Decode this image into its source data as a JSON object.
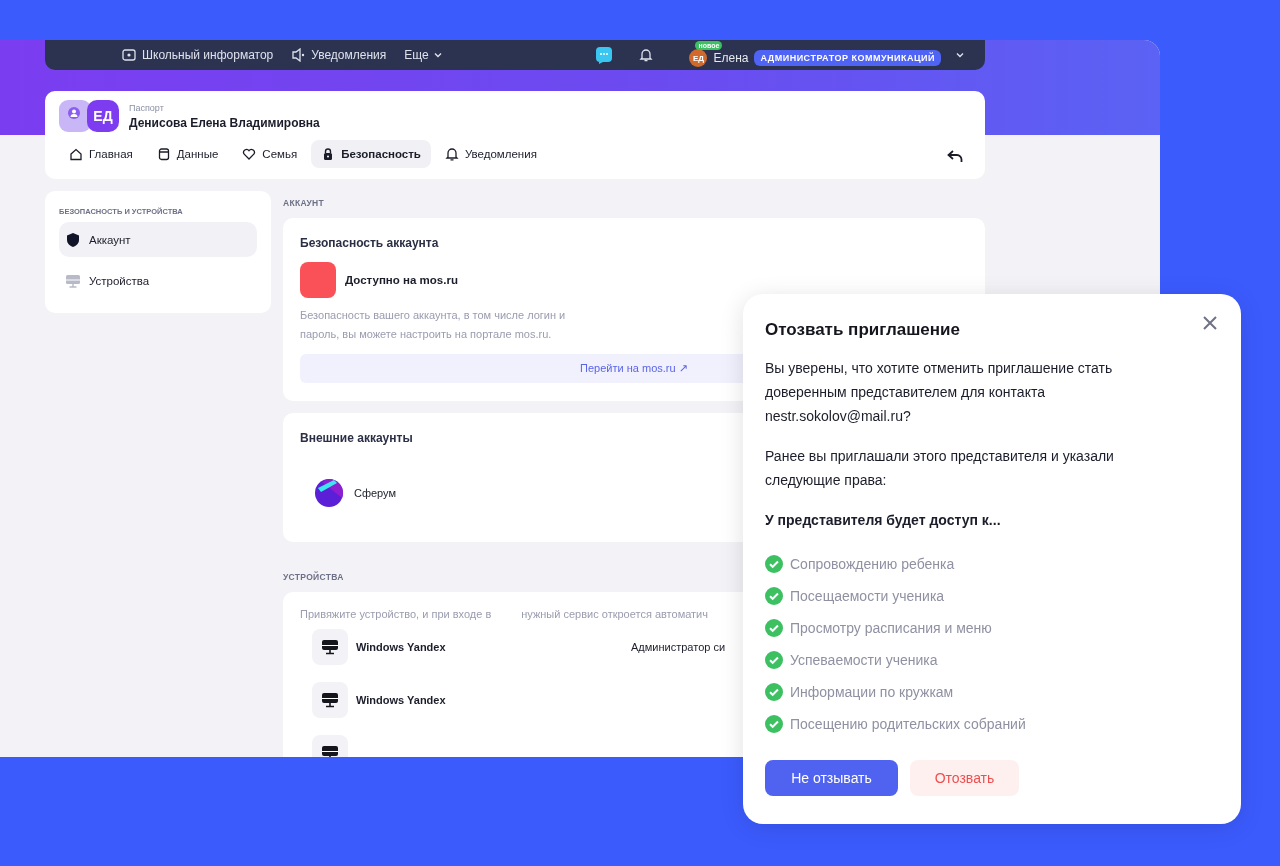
{
  "top_nav": {
    "links": [
      {
        "label": "Школьный информатор"
      },
      {
        "label": "Уведомления"
      }
    ],
    "more": "Еще",
    "user": {
      "initials": "ЕД",
      "badge": "новое",
      "name": "Елена",
      "role": "АДМИНИСТРАТОР КОММУНИКАЦИЙ"
    }
  },
  "profile": {
    "label": "Паспорт",
    "initials": "ЕД",
    "name": "Денисова Елена Владимировна"
  },
  "tabs": [
    {
      "label": "Главная",
      "selected": false
    },
    {
      "label": "Данные",
      "selected": false
    },
    {
      "label": "Семья",
      "selected": false
    },
    {
      "label": "Безопасность",
      "selected": true
    },
    {
      "label": "Уведомления",
      "selected": false
    }
  ],
  "sidebar": {
    "heading": "БЕЗОПАСНОСТЬ И УСТРОЙСТВА",
    "items": [
      {
        "label": "Аккаунт",
        "selected": true
      },
      {
        "label": "Устройства",
        "selected": false
      }
    ]
  },
  "account_section": {
    "heading": "АККАУНТ",
    "security_card": {
      "title": "Безопасность аккаунта",
      "service": "Доступно на mos.ru",
      "description": "Безопасность вашего аккаунта, в том числе логин и пароль, вы можете настроить на портале mos.ru.",
      "link": "Перейти на mos.ru ↗"
    },
    "external_card": {
      "title": "Внешние аккаунты",
      "accounts": [
        {
          "name": "Сферум"
        }
      ]
    }
  },
  "devices_section": {
    "heading": "УСТРОЙСТВА",
    "hint_1": "Привяжите устройство, и при входе в",
    "hint_2": "нужный сервис откроется автоматич",
    "devices": [
      {
        "name": "Windows Yandex",
        "column_2": "Администратор си"
      },
      {
        "name": "Windows Yandex"
      }
    ]
  },
  "dialog": {
    "title": "Отозвать приглашение",
    "message_1": "Вы уверены, что хотите отменить приглашение стать доверенным представителем для контакта nestr.sokolov@mail.ru?",
    "message_2": "Ранее вы приглашали этого представителя и указали следующие права:",
    "access_heading": "У представителя будет доступ к...",
    "permissions": [
      {
        "label": "Сопровождению ребенка",
        "checked": true
      },
      {
        "label": "Посещаемости ученика",
        "checked": true
      },
      {
        "label": "Просмотру расписания и меню",
        "checked": true
      },
      {
        "label": "Успеваемости ученика",
        "checked": true
      },
      {
        "label": "Информации по кружкам",
        "checked": true
      },
      {
        "label": "Посещению родительских собраний",
        "checked": true
      }
    ],
    "buttons": [
      {
        "label": "Не отзывать",
        "kind": "primary"
      },
      {
        "label": "Отозвать",
        "kind": "danger"
      }
    ]
  }
}
